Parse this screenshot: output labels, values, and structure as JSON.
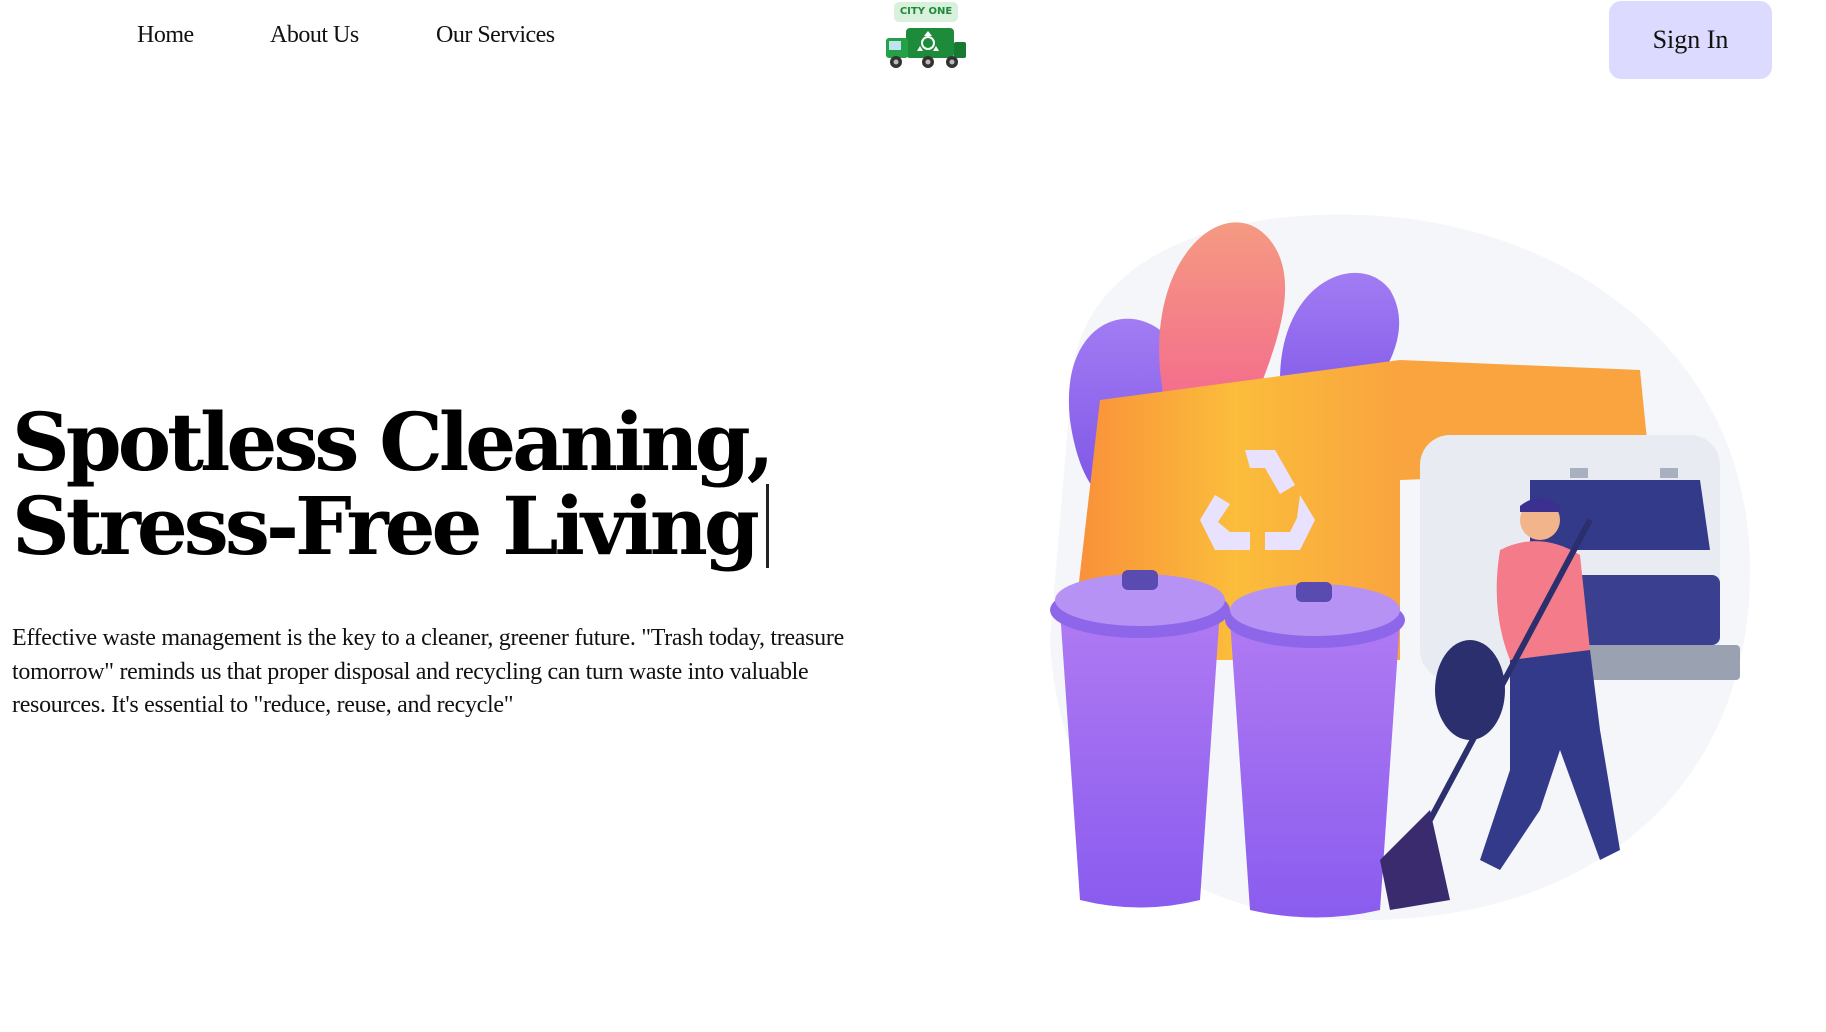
{
  "nav": {
    "links": [
      {
        "label": "Home"
      },
      {
        "label": "About Us"
      },
      {
        "label": "Our Services"
      }
    ],
    "logo_text": "CITY ONE",
    "signin_label": "Sign In"
  },
  "hero": {
    "title_line1": "Spotless Cleaning,",
    "title_line2": "Stress-Free Living",
    "description": "Effective waste management is the key to a cleaner, greener future. \"Trash today, treasure tomorrow\" reminds us that proper disposal and recycling can turn waste into valuable resources. It's essential to \"reduce, reuse, and recycle\""
  },
  "colors": {
    "signin_bg": "#dcdaff",
    "logo_truck": "#1e8b3a",
    "illustration_truck": "#f9a43f",
    "illustration_bins": "#9b6cf0",
    "illustration_leaf_pink": "#f47c8a"
  },
  "icons": [
    "garbage-truck-logo-icon",
    "recycle-icon",
    "trash-bin-icon",
    "hero-illustration"
  ]
}
